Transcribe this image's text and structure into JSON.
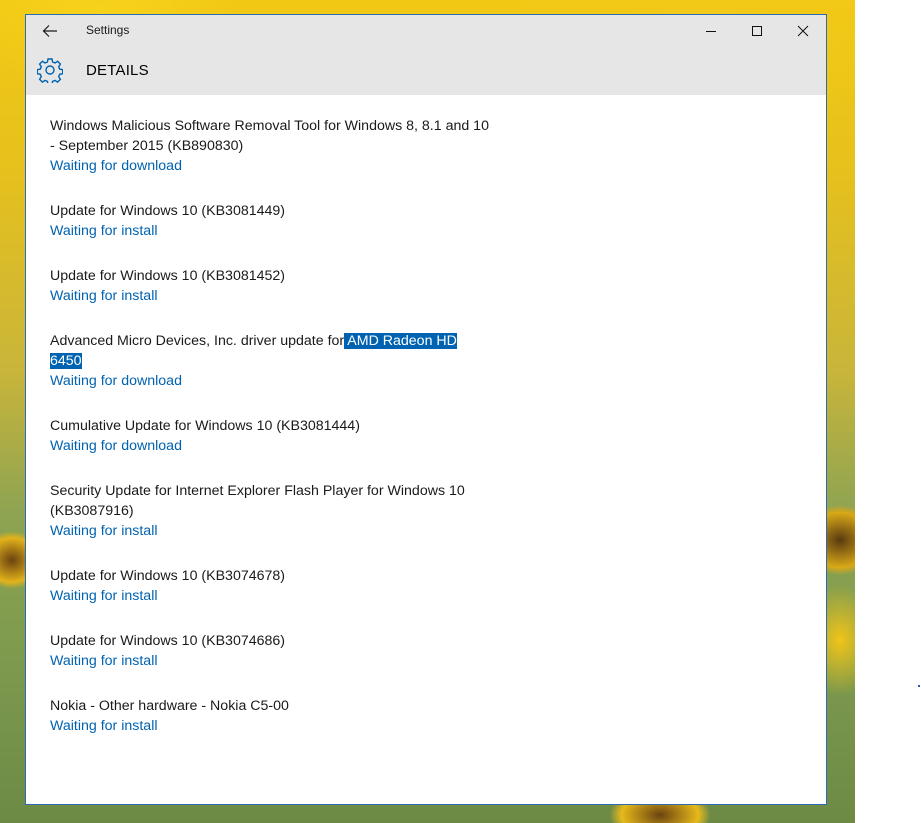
{
  "window": {
    "title": "Settings",
    "back_icon": "arrow-left-icon",
    "controls": {
      "minimize_icon": "minimize-icon",
      "maximize_icon": "maximize-icon",
      "close_icon": "close-icon"
    }
  },
  "header": {
    "icon": "gear-icon",
    "title": "DETAILS"
  },
  "colors": {
    "accent": "#0063b1",
    "header_bg": "#e6e6e6",
    "window_border": "#2b6cb0",
    "selection_bg": "#0063b1"
  },
  "updates": [
    {
      "name": "Windows Malicious Software Removal Tool for Windows 8, 8.1 and 10 - September 2015 (KB890830)",
      "status": "Waiting for download"
    },
    {
      "name": "Update for Windows 10 (KB3081449)",
      "status": "Waiting for install"
    },
    {
      "name": "Update for Windows 10 (KB3081452)",
      "status": "Waiting for install"
    },
    {
      "name_prefix": "Advanced Micro Devices, Inc. driver update for",
      "name_selected": " AMD Radeon HD 6450",
      "status": "Waiting for download"
    },
    {
      "name": "Cumulative Update for Windows 10 (KB3081444)",
      "status": "Waiting for download"
    },
    {
      "name": "Security Update for Internet Explorer Flash Player for Windows 10 (KB3087916)",
      "status": "Waiting for install"
    },
    {
      "name": "Update for Windows 10 (KB3074678)",
      "status": "Waiting for install"
    },
    {
      "name": "Update for Windows 10 (KB3074686)",
      "status": "Waiting for install"
    },
    {
      "name": "Nokia - Other hardware - Nokia C5-00",
      "status": "Waiting for install"
    }
  ]
}
